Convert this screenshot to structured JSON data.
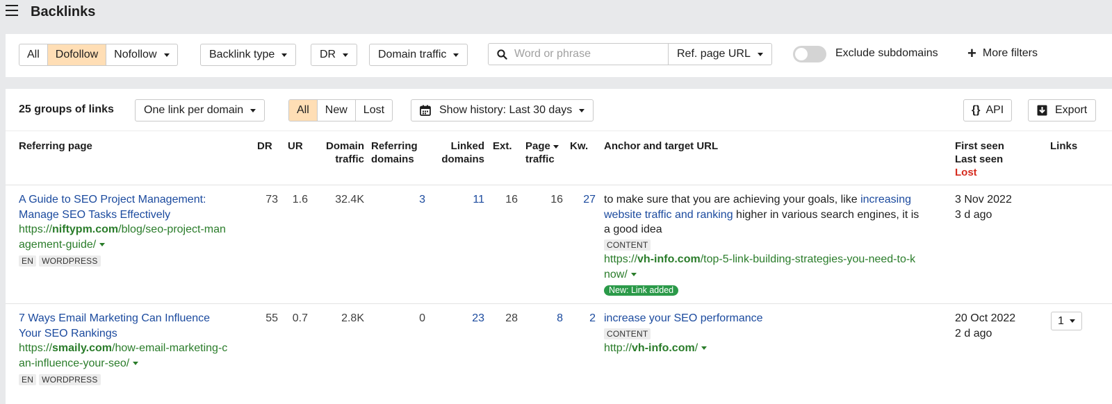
{
  "page": {
    "title": "Backlinks"
  },
  "filters": {
    "link_type": [
      "All",
      "Dofollow",
      "Nofollow"
    ],
    "link_type_active": "Dofollow",
    "backlink_type": "Backlink type",
    "dr": "DR",
    "domain_traffic": "Domain traffic",
    "search_placeholder": "Word or phrase",
    "ref_page_url": "Ref. page URL",
    "exclude_subdomains": "Exclude subdomains",
    "more_filters": "More filters",
    "more_filters_icon": "+"
  },
  "toolbar": {
    "groups_count": "25 groups of links",
    "grouping": "One link per domain",
    "status_tabs": [
      "All",
      "New",
      "Lost"
    ],
    "status_active": "All",
    "history": "Show history: Last 30 days",
    "api_label": "API",
    "api_icon": "{}",
    "export_label": "Export"
  },
  "table": {
    "headers": {
      "referring_page": "Referring page",
      "dr": "DR",
      "ur": "UR",
      "domain_traffic": [
        "Domain",
        "traffic"
      ],
      "referring_domains": [
        "Referring",
        "domains"
      ],
      "linked_domains": [
        "Linked",
        "domains"
      ],
      "ext": "Ext.",
      "page_traffic": [
        "Page",
        "traffic"
      ],
      "kw": "Kw.",
      "anchor": "Anchor and target URL",
      "seen": [
        "First seen",
        "Last seen",
        "Lost"
      ],
      "links": "Links"
    },
    "rows": [
      {
        "title": [
          "A Guide to SEO Project Management:",
          "Manage SEO Tasks Effectively"
        ],
        "url_prefix": "https://",
        "url_domain": "niftypm.com",
        "url_path_1": "/blog/seo-project-man",
        "url_path_2": "agement-guide/",
        "tags": [
          "EN",
          "WORDPRESS"
        ],
        "dr": "73",
        "ur": "1.6",
        "domain_traffic": "32.4K",
        "referring_domains": "3",
        "linked_domains": "11",
        "ext": "16",
        "page_traffic": "16",
        "kw": "27",
        "anchor_before_1": "to make sure that you are achieving your goals, like ",
        "anchor_link_1": "increasing",
        "anchor_link_2": "website traffic and ranking",
        "anchor_after_2": " higher in various search engines, it is",
        "anchor_line_3": "a good idea",
        "anchor_tag": "CONTENT",
        "target_prefix": "https://",
        "target_domain": "vh-info.com",
        "target_path_1": "/top-5-link-building-strategies-you-need-to-k",
        "target_path_2": "now/",
        "badge": "New: Link added",
        "first_seen": "3 Nov 2022",
        "last_seen": "3 d ago"
      },
      {
        "title": [
          "7 Ways Email Marketing Can Influence",
          "Your SEO Rankings"
        ],
        "url_prefix": "https://",
        "url_domain": "smaily.com",
        "url_path_1": "/how-email-marketing-c",
        "url_path_2": "an-influence-your-seo/",
        "tags": [
          "EN",
          "WORDPRESS"
        ],
        "dr": "55",
        "ur": "0.7",
        "domain_traffic": "2.8K",
        "referring_domains": "0",
        "linked_domains": "23",
        "ext": "28",
        "page_traffic": "8",
        "kw": "2",
        "anchor_link": "increase your SEO performance",
        "anchor_tag": "CONTENT",
        "target_prefix": "http://",
        "target_domain": "vh-info.com",
        "target_path": "/",
        "first_seen": "20 Oct 2022",
        "last_seen": "2 d ago",
        "links_count": "1"
      }
    ]
  },
  "colors": {
    "accent_active": "#ffdeb5",
    "link_blue": "#1b4a9e",
    "url_green": "#2a7c2a",
    "lost_red": "#d52b1e",
    "badge_green": "#2b9a49"
  }
}
